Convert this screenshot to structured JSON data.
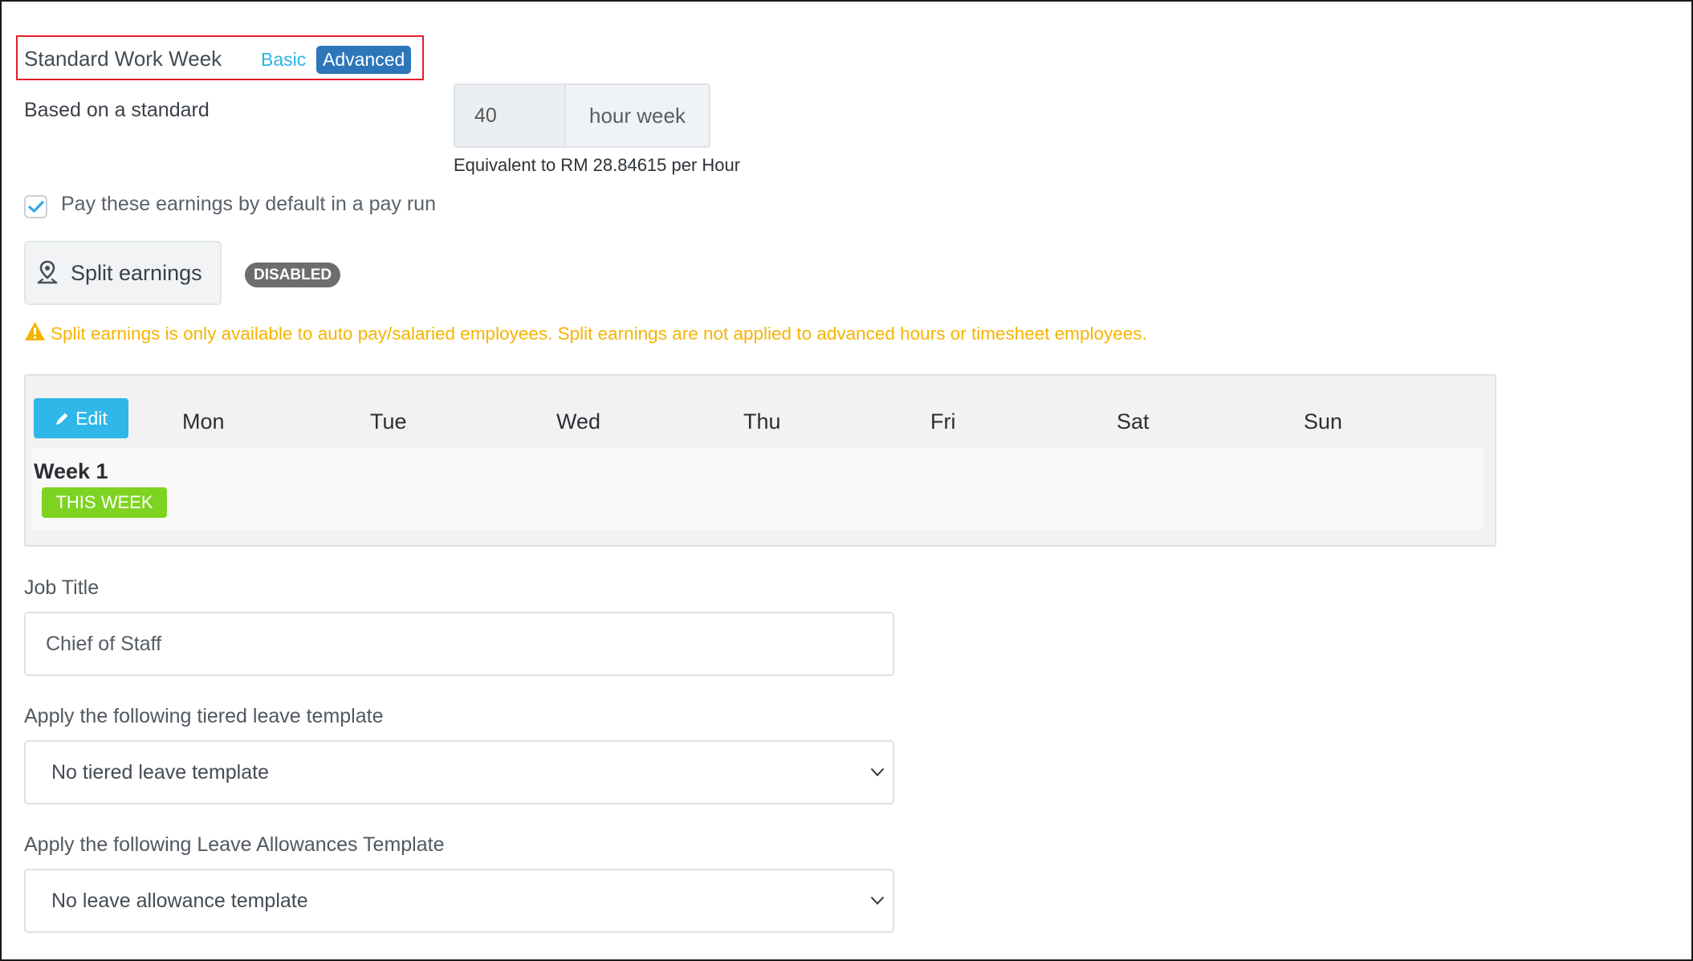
{
  "header": {
    "title": "Standard Work Week",
    "mode_basic": "Basic",
    "mode_advanced": "Advanced",
    "mode_selected": "Advanced"
  },
  "hours": {
    "label": "Based on a standard",
    "value": "40",
    "suffix": "hour week",
    "equivalent": "Equivalent to RM 28.84615 per Hour"
  },
  "pay_default": {
    "label": "Pay these earnings by default in a pay run",
    "checked": true
  },
  "split": {
    "button_label": "Split earnings",
    "icon": "map-pin-icon",
    "badge": "DISABLED",
    "warning": "Split earnings is only available to auto pay/salaried employees. Split earnings are not applied to advanced hours or timesheet employees."
  },
  "schedule": {
    "edit_label": "Edit",
    "days": [
      "Mon",
      "Tue",
      "Wed",
      "Thu",
      "Fri",
      "Sat",
      "Sun"
    ],
    "week_label": "Week 1",
    "this_week_badge": "THIS WEEK"
  },
  "job_title": {
    "label": "Job Title",
    "value": "Chief of Staff"
  },
  "tiered_leave": {
    "label": "Apply the following tiered leave template",
    "value": "No tiered leave template"
  },
  "leave_allowance": {
    "label": "Apply the following Leave Allowances Template",
    "value": "No leave allowance template"
  },
  "colors": {
    "accent_blue": "#2fb7ea",
    "advanced_blue": "#2d76b9",
    "warning": "#f5b400",
    "success_green": "#7ed321",
    "highlight_red": "#e0202b"
  }
}
